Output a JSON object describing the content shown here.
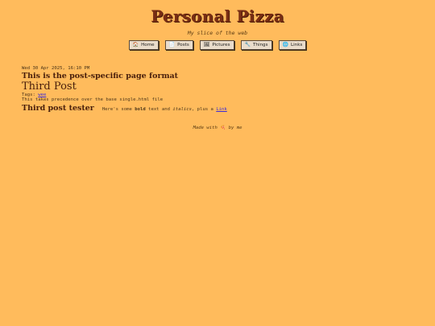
{
  "site": {
    "title": "Personal Pizza",
    "tagline": "My slice of the web"
  },
  "nav": [
    {
      "label": "Home",
      "icon": "home-icon",
      "glyph": "🏠"
    },
    {
      "label": "Posts",
      "icon": "posts-icon",
      "glyph": "📄"
    },
    {
      "label": "Pictures",
      "icon": "pictures-icon",
      "glyph": "🖼"
    },
    {
      "label": "Things",
      "icon": "things-icon",
      "glyph": "🔧"
    },
    {
      "label": "Links",
      "icon": "links-icon",
      "glyph": "🌐"
    }
  ],
  "post": {
    "date": "Wed 30 Apr 2025, 16:10 PM",
    "format_heading": "This is the post-specific page format",
    "title": "Third Post",
    "tags_label": "Tags:",
    "tag": "wee",
    "note": "This takes precedence over the base single.html file",
    "subheading": "Third post tester",
    "body_prefix": "Here's some",
    "body_bold": "bold",
    "body_mid": "text and",
    "body_italic": "italics",
    "body_suffix": ", plus a",
    "body_link": "Link"
  },
  "footer": {
    "prefix": "Made with",
    "glyph": "🍕",
    "suffix": "by me"
  },
  "colors": {
    "background": "#ffbb5c",
    "title": "#7a2e14",
    "link": "#3b2bd8"
  }
}
